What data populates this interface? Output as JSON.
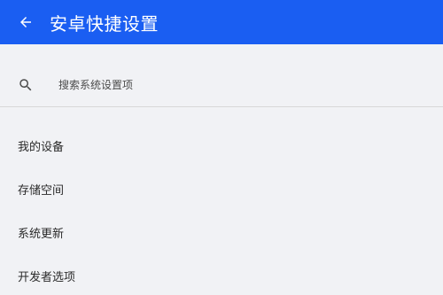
{
  "appbar": {
    "title": "安卓快捷设置",
    "back_icon": "arrow-left-icon"
  },
  "search": {
    "placeholder": "搜索系统设置项",
    "icon": "search-icon"
  },
  "settings": {
    "items": [
      {
        "label": "我的设备"
      },
      {
        "label": "存储空间"
      },
      {
        "label": "系统更新"
      },
      {
        "label": "开发者选项"
      }
    ]
  },
  "colors": {
    "appbar_bg": "#1a5ef2",
    "page_bg": "#f1f2f5",
    "text": "#2a2a2a"
  }
}
